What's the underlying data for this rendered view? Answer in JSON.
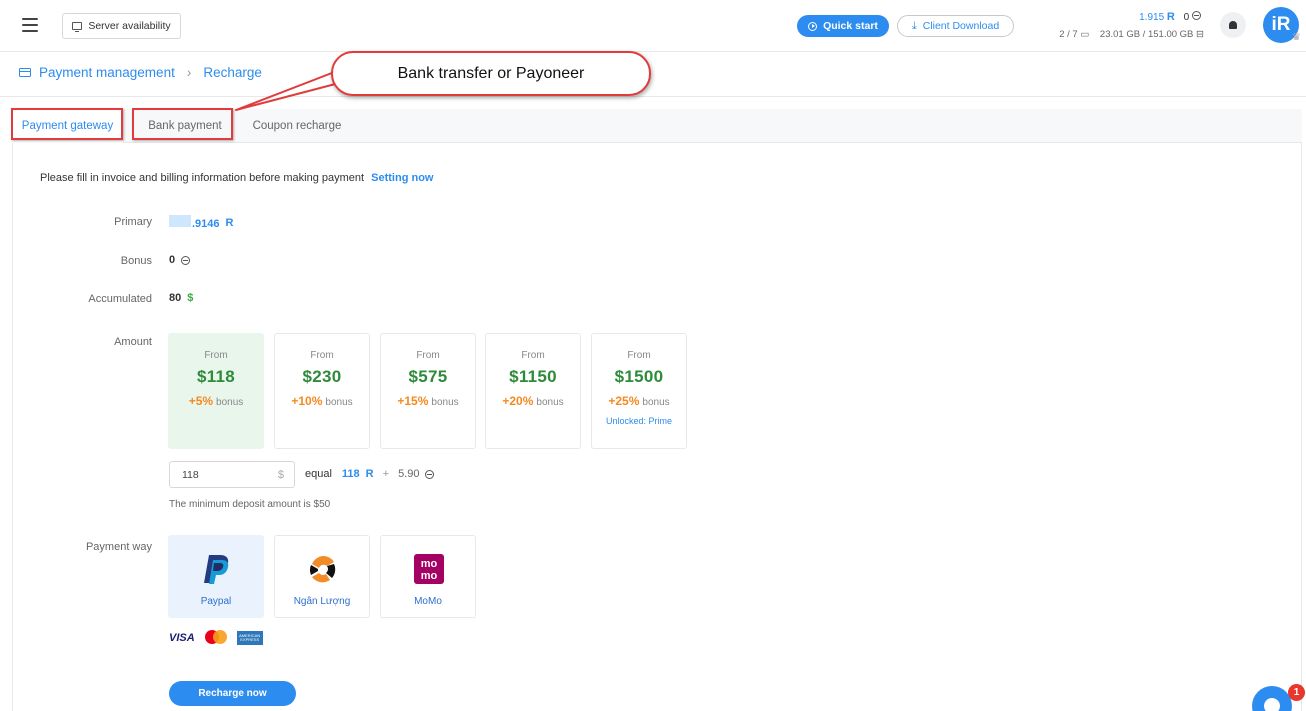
{
  "header": {
    "server_availability": "Server availability",
    "quick_start": "Quick start",
    "client_download": "Client Download",
    "balance": "1.915",
    "coins": "0",
    "profiles": "2 / 7",
    "storage": "23.01 GB / 151.00 GB",
    "logo_text": "iR"
  },
  "breadcrumb": {
    "section": "Payment management",
    "page": "Recharge"
  },
  "annotation": {
    "text": "Bank transfer or Payoneer",
    "color": "#e23b3b"
  },
  "tabs": [
    {
      "label": "Payment gateway",
      "active": true
    },
    {
      "label": "Bank payment",
      "active": false
    },
    {
      "label": "Coupon recharge",
      "active": false
    }
  ],
  "notice": {
    "text": "Please fill in invoice and billing information before making payment",
    "link": "Setting now"
  },
  "account": {
    "primary_label": "Primary",
    "primary_value": ".9146",
    "bonus_label": "Bonus",
    "bonus_value": "0",
    "accumulated_label": "Accumulated",
    "accumulated_value": "80",
    "accumulated_unit": "$"
  },
  "amount": {
    "label": "Amount",
    "options": [
      {
        "from": "From",
        "price": "$118",
        "bonus_pct": "+5%",
        "bonus_word": "bonus",
        "extra": "",
        "selected": true
      },
      {
        "from": "From",
        "price": "$230",
        "bonus_pct": "+10%",
        "bonus_word": "bonus",
        "extra": "",
        "selected": false
      },
      {
        "from": "From",
        "price": "$575",
        "bonus_pct": "+15%",
        "bonus_word": "bonus",
        "extra": "",
        "selected": false
      },
      {
        "from": "From",
        "price": "$1150",
        "bonus_pct": "+20%",
        "bonus_word": "bonus",
        "extra": "",
        "selected": false
      },
      {
        "from": "From",
        "price": "$1500",
        "bonus_pct": "+25%",
        "bonus_word": "bonus",
        "extra": "Unlocked: Prime",
        "selected": false
      }
    ],
    "input_value": "118",
    "input_suffix": "$",
    "equal_label": "equal",
    "equal_value": "118",
    "plus": "+",
    "bonus_amount": "5.90",
    "min_deposit": "The minimum deposit amount is $50"
  },
  "payment_way": {
    "label": "Payment way",
    "options": [
      {
        "name": "Paypal",
        "icon": "paypal-logo",
        "selected": true
      },
      {
        "name": "Ngân Lượng",
        "icon": "nganluong-logo",
        "selected": false
      },
      {
        "name": "MoMo",
        "icon": "momo-logo",
        "selected": false
      }
    ],
    "card_brands": {
      "visa": "VISA",
      "amex": "AMERICAN EXPRESS"
    }
  },
  "recharge_button": "Recharge now",
  "chat": {
    "badge": "1"
  },
  "colors": {
    "accent": "#2d8cf0",
    "price_green": "#2e8b3a",
    "bonus_orange": "#f5891f",
    "annotation_red": "#e23b3b"
  }
}
